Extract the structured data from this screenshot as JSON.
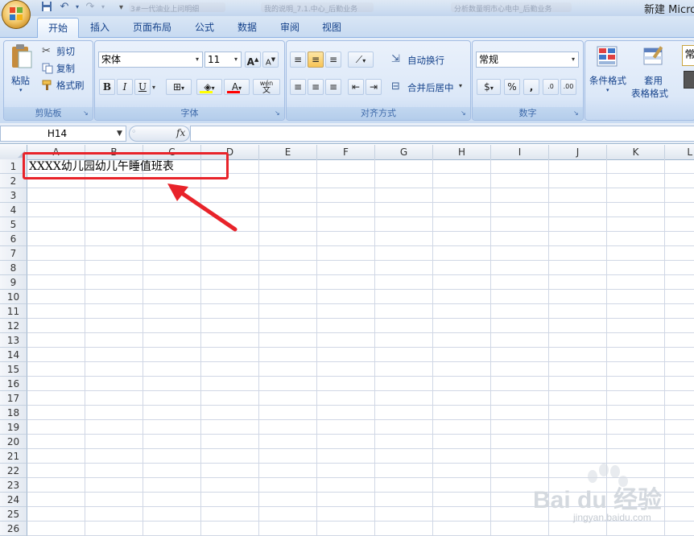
{
  "app": {
    "title": "新建 Micro",
    "blurred_tabs": [
      "3#一代油业上问明细",
      "我的说明_7.1.中心_后勤业务",
      "分析数量明市心电中_后勤业务"
    ]
  },
  "ribbon": {
    "tabs": [
      {
        "label": "开始"
      },
      {
        "label": "插入"
      },
      {
        "label": "页面布局"
      },
      {
        "label": "公式"
      },
      {
        "label": "数据"
      },
      {
        "label": "审阅"
      },
      {
        "label": "视图"
      }
    ],
    "clipboard": {
      "paste": "粘贴",
      "cut": "剪切",
      "copy": "复制",
      "format_painter": "格式刷",
      "label": "剪贴板"
    },
    "font": {
      "name": "宋体",
      "size": "11",
      "label": "字体",
      "bold": "B",
      "italic": "I",
      "underline": "U",
      "phonetic": "wén"
    },
    "alignment": {
      "wrap": "自动换行",
      "merge": "合并后居中",
      "label": "对齐方式"
    },
    "number": {
      "format": "常规",
      "percent": "%",
      "comma": ",",
      "label": "数字"
    },
    "styles": {
      "conditional": "条件格式",
      "table_format_1": "套用",
      "table_format_2": "表格格式",
      "extra": "常"
    }
  },
  "formula_bar": {
    "name_box": "H14",
    "fx": "fx",
    "content": ""
  },
  "grid": {
    "columns": [
      "A",
      "B",
      "C",
      "D",
      "E",
      "F",
      "G",
      "H",
      "I",
      "J",
      "K",
      "L"
    ],
    "rows": [
      "1",
      "2",
      "3",
      "4",
      "5",
      "6",
      "7",
      "8",
      "9",
      "10",
      "11",
      "12",
      "13",
      "14",
      "15",
      "16",
      "17",
      "18",
      "19",
      "20",
      "21",
      "22",
      "23",
      "24",
      "25",
      "26"
    ],
    "a1_value": "XXXX幼儿园幼儿午睡值班表"
  },
  "watermark": {
    "text": "Bai du 经验",
    "sub": "jingyan.baidu.com"
  },
  "colors": {
    "highlight": "#e8232a",
    "ribbon_text": "#15428b"
  }
}
